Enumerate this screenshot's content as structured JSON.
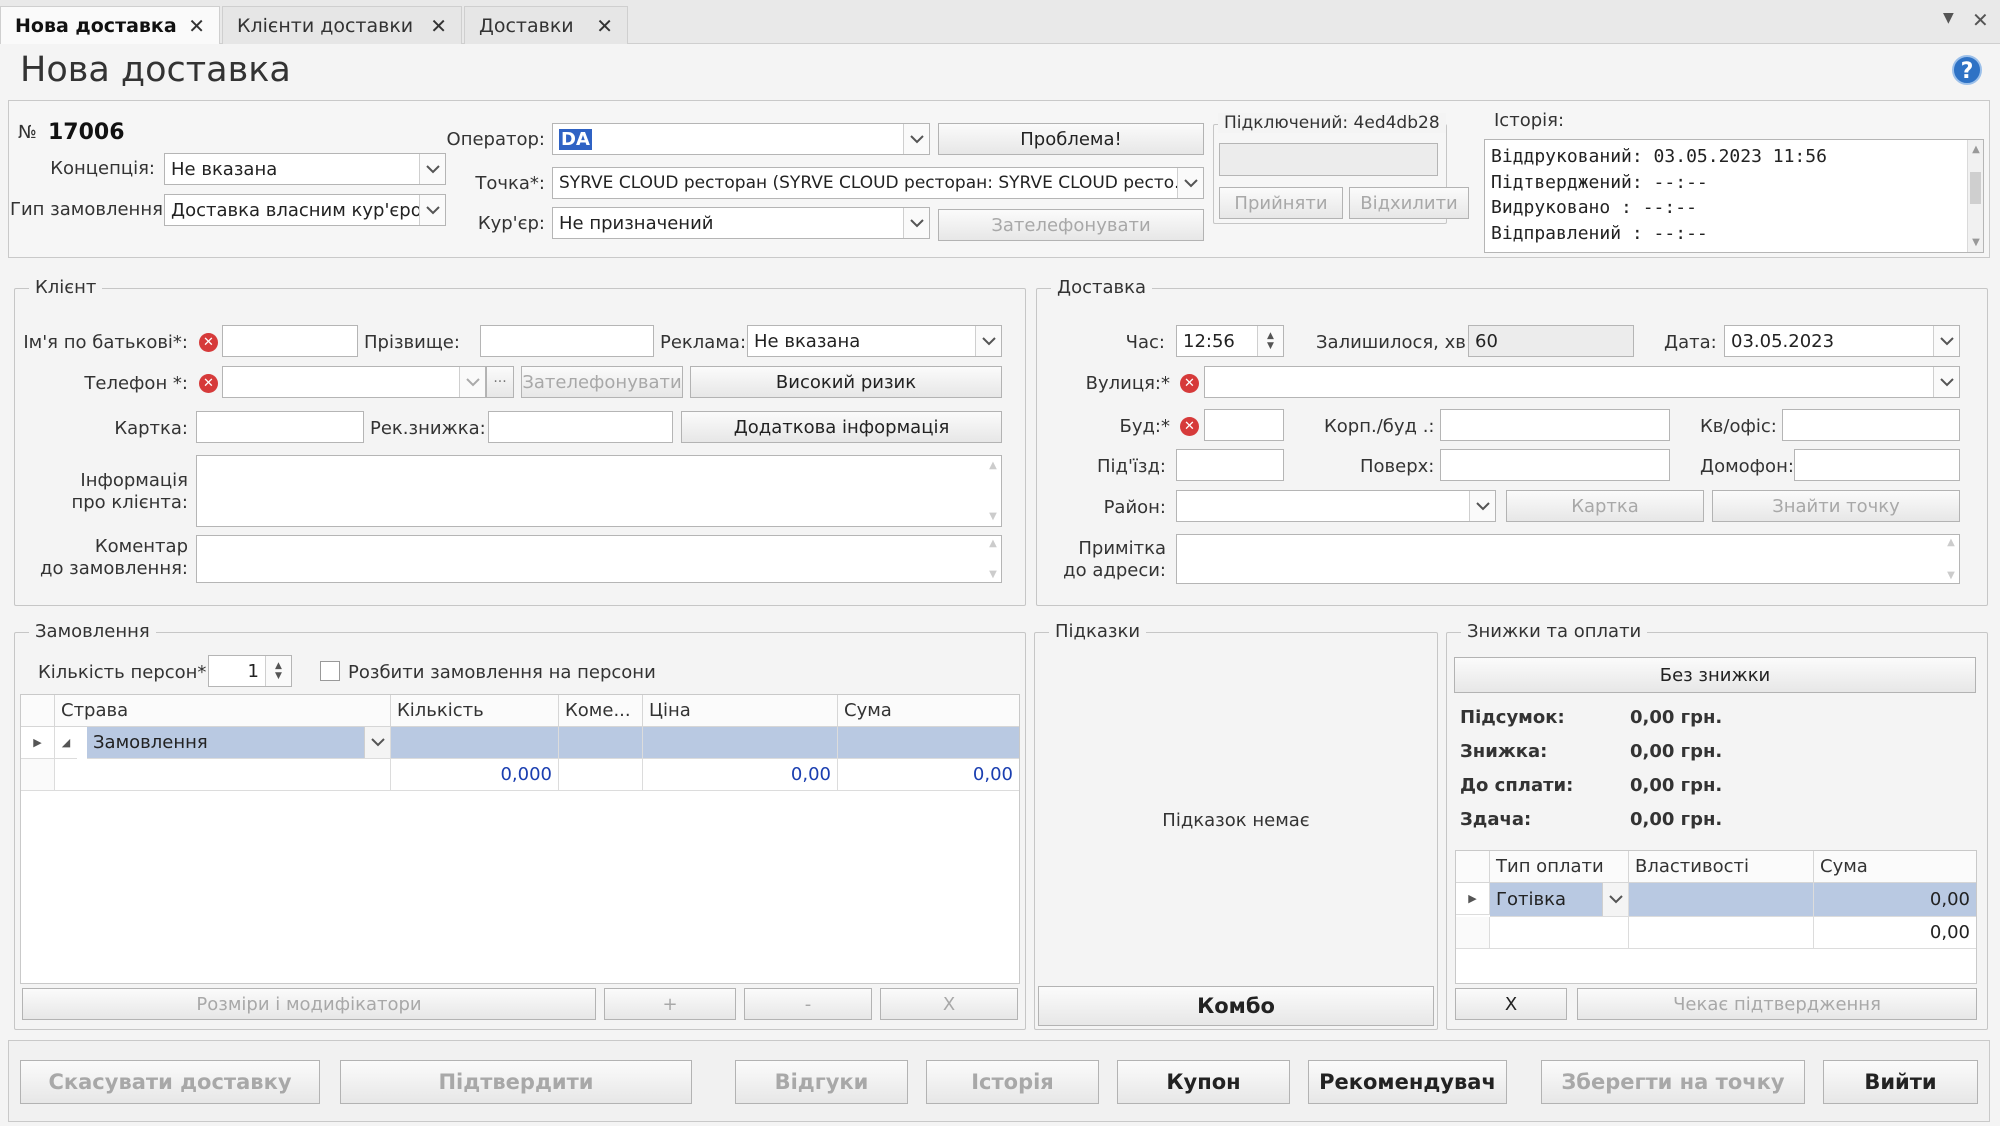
{
  "tabs": [
    {
      "label": "Нова доставка"
    },
    {
      "label": "Клієнти доставки"
    },
    {
      "label": "Доставки"
    }
  ],
  "page_title": "Нова доставка",
  "header": {
    "order_no_label": "№",
    "order_no": "17006",
    "concept_label": "Концепція:",
    "concept_value": "Не вказана",
    "order_type_label": "Гип замовлення:",
    "order_type_value": "Доставка власним кур'єром",
    "operator_label": "Оператор:",
    "operator_value": "DA",
    "point_label": "Точка*:",
    "point_value": "SYRVE CLOUD ресторан (SYRVE CLOUD ресторан: SYRVE CLOUD ресто...",
    "courier_label": "Кур'єр:",
    "courier_value": "Не призначений",
    "problem_button": "Проблема!",
    "call_button": "Зателефонувати",
    "connected_label": "Підключений: 4ed4db28",
    "accept_button": "Прийняти",
    "reject_button": "Відхилити",
    "history_label": "Історія:",
    "history_lines": [
      "Віддрукований: 03.05.2023 11:56",
      "Підтверджений: --:--",
      "Видруковано   : --:--",
      "Відправлений    : --:--"
    ]
  },
  "client": {
    "legend": "Клієнт",
    "patronymic_label": "Ім'я по батькові*:",
    "surname_label": "Прізвище:",
    "ads_label": "Реклама:",
    "ads_value": "Не вказана",
    "phone_label": "Телефон *:",
    "call_button": "Зателефонувати",
    "high_risk_button": "Високий ризик",
    "card_label": "Картка:",
    "rec_discount_label": "Рек.знижка:",
    "extra_info_button": "Додаткова інформація",
    "client_info_label_1": "Інформація",
    "client_info_label_2": "про клієнта:",
    "comment_label_1": "Коментар",
    "comment_label_2": "до замовлення:",
    "more_glyph": "···"
  },
  "delivery": {
    "legend": "Доставка",
    "time_label": "Час:",
    "time_value": "12:56",
    "remaining_label": "Залишилося, хв:",
    "remaining_value": "60",
    "date_label": "Дата:",
    "date_value": "03.05.2023",
    "street_label": "Вулиця:*",
    "building_label": "Буд:*",
    "corp_label": "Корп./буд .:",
    "apt_label": "Кв/офіс:",
    "entrance_label": "Під'їзд:",
    "floor_label": "Поверх:",
    "intercom_label": "Домофон:",
    "district_label": "Район:",
    "card_button": "Картка",
    "find_point_button": "Знайти точку",
    "note_label_1": "Примітка",
    "note_label_2": "до адреси:"
  },
  "order": {
    "legend": "Замовлення",
    "persons_label": "Кількість персон*:",
    "persons_value": "1",
    "split_label": "Розбити замовлення на персони",
    "columns": [
      "Страва",
      "Кількість",
      "Коме...",
      "Ціна",
      "Сума"
    ],
    "row_label": "Замовлення",
    "qty_total": "0,000",
    "price_total": "0,00",
    "sum_total": "0,00",
    "sizes_button": "Розміри і модифікатори",
    "plus_button": "+",
    "minus_button": "-",
    "x_button": "X"
  },
  "hints": {
    "legend": "Підказки",
    "empty_text": "Підказок немає",
    "combo_button": "Комбо"
  },
  "payments": {
    "legend": "Знижки та оплати",
    "no_discount_button": "Без знижки",
    "subtotal_label": "Підсумок:",
    "subtotal_value": "0,00 грн.",
    "discount_label": "Знижка:",
    "discount_value": "0,00 грн.",
    "to_pay_label": "До сплати:",
    "to_pay_value": "0,00 грн.",
    "change_label": "Здача:",
    "change_value": "0,00 грн.",
    "columns": [
      "Тип оплати",
      "Властивості",
      "Сума"
    ],
    "row_type": "Готівка",
    "row_sum": "0,00",
    "total_sum": "0,00",
    "x_button": "X",
    "waiting_button": "Чекає підтвердження"
  },
  "footer": {
    "cancel": "Скасувати доставку",
    "confirm": "Підтвердити",
    "feedback": "Відгуки",
    "history": "Історія",
    "coupon": "Купон",
    "referrer": "Рекомендувач",
    "save_to_point": "Зберегти на точку",
    "exit": "Вийти"
  },
  "colors": {
    "selection": "#b9c9e2",
    "error": "#d63a3a",
    "value_blue": "#1a3eb0",
    "help": "#2e72c5"
  }
}
